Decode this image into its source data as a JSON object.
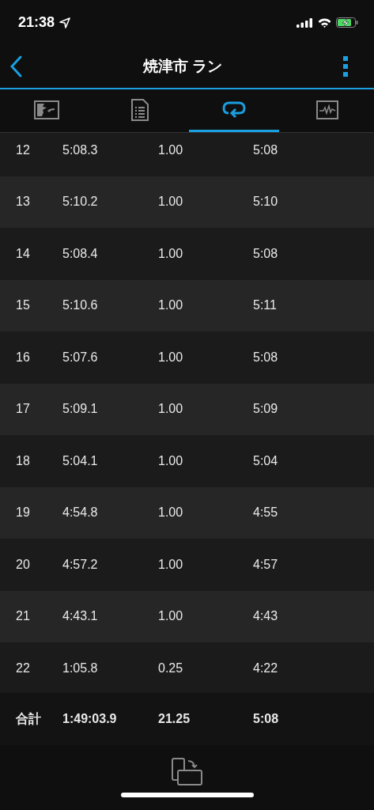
{
  "status_bar": {
    "time": "21:38"
  },
  "header": {
    "title": "焼津市 ラン"
  },
  "tabs": [
    {
      "kind": "map",
      "selected": false
    },
    {
      "kind": "details",
      "selected": false
    },
    {
      "kind": "laps",
      "selected": true
    },
    {
      "kind": "chart",
      "selected": false
    }
  ],
  "laps": {
    "rows": [
      {
        "lap": "12",
        "time": "5:08.3",
        "distance": "1.00",
        "pace": "5:08"
      },
      {
        "lap": "13",
        "time": "5:10.2",
        "distance": "1.00",
        "pace": "5:10"
      },
      {
        "lap": "14",
        "time": "5:08.4",
        "distance": "1.00",
        "pace": "5:08"
      },
      {
        "lap": "15",
        "time": "5:10.6",
        "distance": "1.00",
        "pace": "5:11"
      },
      {
        "lap": "16",
        "time": "5:07.6",
        "distance": "1.00",
        "pace": "5:08"
      },
      {
        "lap": "17",
        "time": "5:09.1",
        "distance": "1.00",
        "pace": "5:09"
      },
      {
        "lap": "18",
        "time": "5:04.1",
        "distance": "1.00",
        "pace": "5:04"
      },
      {
        "lap": "19",
        "time": "4:54.8",
        "distance": "1.00",
        "pace": "4:55"
      },
      {
        "lap": "20",
        "time": "4:57.2",
        "distance": "1.00",
        "pace": "4:57"
      },
      {
        "lap": "21",
        "time": "4:43.1",
        "distance": "1.00",
        "pace": "4:43"
      },
      {
        "lap": "22",
        "time": "1:05.8",
        "distance": "0.25",
        "pace": "4:22"
      }
    ],
    "total": {
      "label": "合計",
      "time": "1:49:03.9",
      "distance": "21.25",
      "pace": "5:08"
    }
  }
}
